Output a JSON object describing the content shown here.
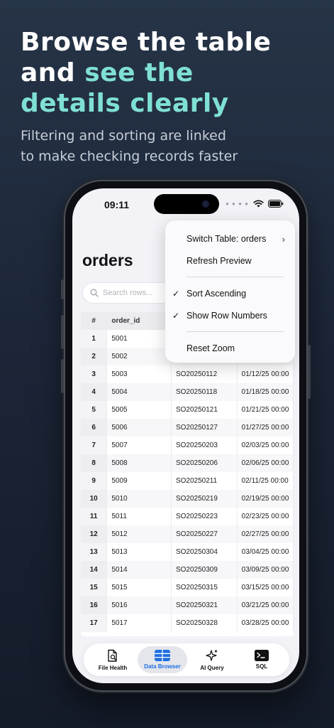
{
  "hero": {
    "line1": "Browse the table",
    "line2_prefix": "and ",
    "line2_accent": "see the",
    "line3_accent": "details clearly",
    "sub_line1": "Filtering and sorting are linked",
    "sub_line2": "to make checking records faster"
  },
  "status_bar": {
    "time": "09:11"
  },
  "page": {
    "title": "orders"
  },
  "search": {
    "placeholder": "Search rows..."
  },
  "table": {
    "headers": [
      "#",
      "order_id"
    ],
    "rows": [
      {
        "n": "1",
        "order_id": "5001",
        "code": "",
        "date": ""
      },
      {
        "n": "2",
        "order_id": "5002",
        "code": "",
        "date": ""
      },
      {
        "n": "3",
        "order_id": "5003",
        "code": "SO20250112",
        "date": "01/12/25 00:00"
      },
      {
        "n": "4",
        "order_id": "5004",
        "code": "SO20250118",
        "date": "01/18/25 00:00"
      },
      {
        "n": "5",
        "order_id": "5005",
        "code": "SO20250121",
        "date": "01/21/25 00:00"
      },
      {
        "n": "6",
        "order_id": "5006",
        "code": "SO20250127",
        "date": "01/27/25 00:00"
      },
      {
        "n": "7",
        "order_id": "5007",
        "code": "SO20250203",
        "date": "02/03/25 00:00"
      },
      {
        "n": "8",
        "order_id": "5008",
        "code": "SO20250206",
        "date": "02/06/25 00:00"
      },
      {
        "n": "9",
        "order_id": "5009",
        "code": "SO20250211",
        "date": "02/11/25 00:00"
      },
      {
        "n": "10",
        "order_id": "5010",
        "code": "SO20250219",
        "date": "02/19/25 00:00"
      },
      {
        "n": "11",
        "order_id": "5011",
        "code": "SO20250223",
        "date": "02/23/25 00:00"
      },
      {
        "n": "12",
        "order_id": "5012",
        "code": "SO20250227",
        "date": "02/27/25 00:00"
      },
      {
        "n": "13",
        "order_id": "5013",
        "code": "SO20250304",
        "date": "03/04/25 00:00"
      },
      {
        "n": "14",
        "order_id": "5014",
        "code": "SO20250309",
        "date": "03/09/25 00:00"
      },
      {
        "n": "15",
        "order_id": "5015",
        "code": "SO20250315",
        "date": "03/15/25 00:00"
      },
      {
        "n": "16",
        "order_id": "5016",
        "code": "SO20250321",
        "date": "03/21/25 00:00"
      },
      {
        "n": "17",
        "order_id": "5017",
        "code": "SO20250328",
        "date": "03/28/25 00:00"
      }
    ]
  },
  "menu": {
    "switch_table": "Switch Table: orders",
    "refresh": "Refresh Preview",
    "sort_asc": "Sort Ascending",
    "show_row_numbers": "Show Row Numbers",
    "reset_zoom": "Reset Zoom",
    "check_mark": "✓",
    "chevron": "›"
  },
  "tabs": [
    {
      "label": "File Health",
      "icon": "file-search-icon"
    },
    {
      "label": "Data Browser",
      "icon": "table-icon"
    },
    {
      "label": "AI Query",
      "icon": "sparkles-icon"
    },
    {
      "label": "SQL",
      "icon": "terminal-icon"
    }
  ],
  "colors": {
    "accent": "#7fe0d4",
    "active_tab": "#1f6fe0"
  }
}
